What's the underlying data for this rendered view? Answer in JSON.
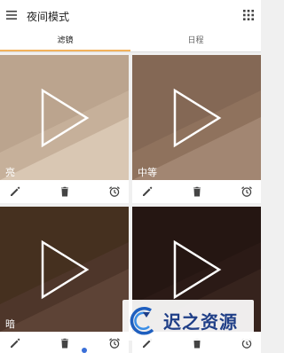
{
  "app": {
    "title": "夜间模式"
  },
  "tabs": [
    {
      "label": "滤镜",
      "active": true
    },
    {
      "label": "日程",
      "active": false
    }
  ],
  "cards": [
    {
      "label": "亮",
      "colors": {
        "base": "#c6b09a",
        "light": "#d9c7b3",
        "dark": "#b39c86"
      }
    },
    {
      "label": "中等",
      "colors": {
        "base": "#8f725d",
        "light": "#a28672",
        "dark": "#7e6450"
      }
    },
    {
      "label": "暗",
      "colors": {
        "base": "#4e362a",
        "light": "#5d4336",
        "dark": "#3f2b21"
      }
    },
    {
      "label": "",
      "colors": {
        "base": "#2b1a16",
        "light": "#36231d",
        "dark": "#211310"
      }
    }
  ],
  "watermark": {
    "text": "迟之资源"
  },
  "colors": {
    "accent": "#f2b25c",
    "icon": "#444444"
  }
}
